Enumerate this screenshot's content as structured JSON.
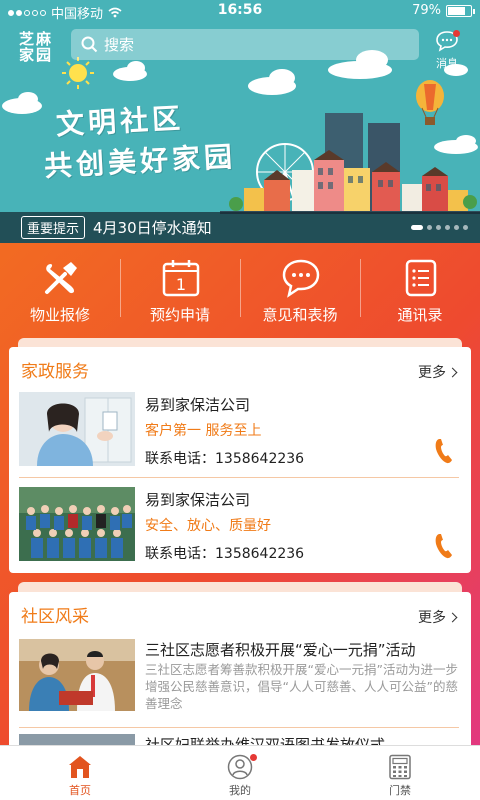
{
  "status_bar": {
    "carrier": "中国移动",
    "time": "16:56",
    "battery": "79%",
    "battery_level": 0.79
  },
  "header": {
    "logo_line1": "芝麻",
    "logo_line2": "家园",
    "search_placeholder": "搜索",
    "message_label": "消息"
  },
  "banner": {
    "slogan_line1": "文明社区",
    "slogan_line2": "共创美好家园",
    "notice_tag": "重要提示",
    "notice_text": "4月30日停水通知",
    "slide_count": 6,
    "active_slide": 0
  },
  "quick_menu": [
    {
      "label": "物业报修",
      "icon": "wrench-hammer-icon"
    },
    {
      "label": "预约申请",
      "icon": "calendar-icon"
    },
    {
      "label": "意见和表扬",
      "icon": "chat-bubble-icon"
    },
    {
      "label": "通讯录",
      "icon": "contact-list-icon"
    }
  ],
  "housekeeping": {
    "title": "家政服务",
    "more": "更多",
    "items": [
      {
        "name": "易到家保洁公司",
        "slogan": "客户第一  服务至上",
        "phone": "联系电话：1358642236"
      },
      {
        "name": "易到家保洁公司",
        "slogan": "安全、放心、质量好",
        "phone": "联系电话：1358642236"
      }
    ]
  },
  "community": {
    "title": "社区风采",
    "more": "更多",
    "items": [
      {
        "title": "三社区志愿者积极开展“爱心一元捐”活动",
        "desc": "三社区志愿者筹善款积极开展“爱心一元捐”活动为进一步增强公民慈善意识，倡导“人人可慈善、人人可公益”的慈善理念"
      },
      {
        "title": "社区妇联举办维汉双语图书发放仪式",
        "desc": ""
      }
    ]
  },
  "tab_bar": [
    {
      "label": "首页",
      "icon": "home-icon",
      "active": true
    },
    {
      "label": "我的",
      "icon": "user-icon",
      "active": false,
      "badge": true
    },
    {
      "label": "门禁",
      "icon": "keypad-icon",
      "active": false
    }
  ],
  "colors": {
    "accent": "#f07b18",
    "banner_bg": "#48b3b8",
    "badge": "#e53935"
  }
}
